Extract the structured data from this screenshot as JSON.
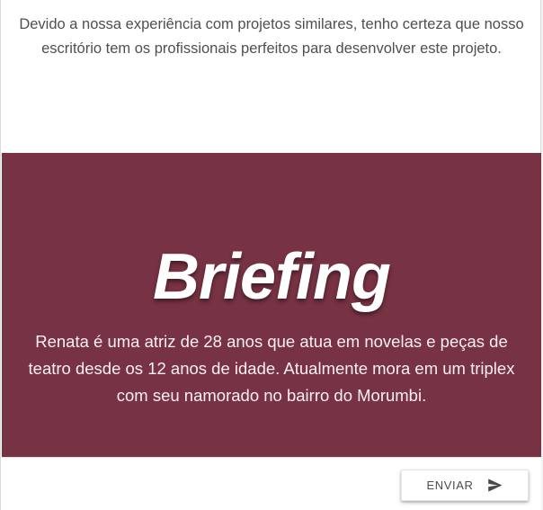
{
  "intro": {
    "text": "Devido a nossa experiência com projetos similares, tenho certeza que nosso escritório tem os profissionais perfeitos para desenvolver este projeto."
  },
  "briefing": {
    "title": "Briefing",
    "description": "Renata é uma atriz de 28 anos que atua em novelas e peças de teatro desde os 12 anos de idade. Atualmente mora em um triplex com seu namorado no bairro do Morumbi.",
    "background_color": "#773243"
  },
  "footer": {
    "send_button_label": "ENVIAR",
    "send_button_icon": "send-icon"
  }
}
